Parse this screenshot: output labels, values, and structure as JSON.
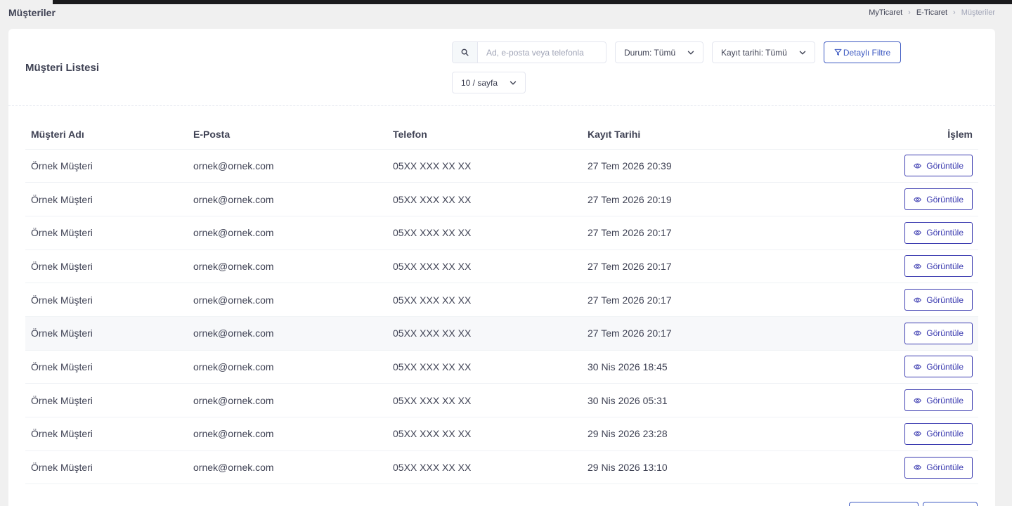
{
  "page": {
    "title": "Müşteriler"
  },
  "breadcrumb": [
    {
      "label": "MyTicaret",
      "active": false
    },
    {
      "label": "E-Ticaret",
      "active": false
    },
    {
      "label": "Müşteriler",
      "active": true
    }
  ],
  "card": {
    "title": "Müşteri Listesi"
  },
  "filters": {
    "search_placeholder": "Ad, e-posta veya telefonla",
    "status_label": "Durum: Tümü",
    "date_label": "Kayıt tarihi: Tümü",
    "detail_filter_label": "Detaylı Filtre",
    "per_page_label": "10 / sayfa"
  },
  "table": {
    "columns": [
      "Müşteri Adı",
      "E-Posta",
      "Telefon",
      "Kayıt Tarihi",
      "İşlem"
    ],
    "action_label": "Görüntüle",
    "rows": [
      [
        "Örnek Müşteri",
        "ornek@ornek.com",
        "05XX XXX XX XX",
        "27 Tem 2026 20:39"
      ],
      [
        "Örnek Müşteri",
        "ornek@ornek.com",
        "05XX XXX XX XX",
        "27 Tem 2026 20:19"
      ],
      [
        "Örnek Müşteri",
        "ornek@ornek.com",
        "05XX XXX XX XX",
        "27 Tem 2026 20:17"
      ],
      [
        "Örnek Müşteri",
        "ornek@ornek.com",
        "05XX XXX XX XX",
        "27 Tem 2026 20:17"
      ],
      [
        "Örnek Müşteri",
        "ornek@ornek.com",
        "05XX XXX XX XX",
        "27 Tem 2026 20:17"
      ],
      [
        "Örnek Müşteri",
        "ornek@ornek.com",
        "05XX XXX XX XX",
        "27 Tem 2026 20:17"
      ],
      [
        "Örnek Müşteri",
        "ornek@ornek.com",
        "05XX XXX XX XX",
        "30 Nis 2026 18:45"
      ],
      [
        "Örnek Müşteri",
        "ornek@ornek.com",
        "05XX XXX XX XX",
        "30 Nis 2026 05:31"
      ],
      [
        "Örnek Müşteri",
        "ornek@ornek.com",
        "05XX XXX XX XX",
        "29 Nis 2026 23:28"
      ],
      [
        "Örnek Müşteri",
        "ornek@ornek.com",
        "05XX XXX XX XX",
        "29 Nis 2026 13:10"
      ]
    ]
  },
  "colors": {
    "accent": "#3e5ac2",
    "view_button": "#3b3bb0",
    "muted": "#a1a5b7",
    "text": "#3f4254"
  },
  "icons": {
    "search": "search-icon",
    "filter": "filter-icon",
    "view": "eye-icon",
    "dropdown": "chevron-down-icon"
  }
}
